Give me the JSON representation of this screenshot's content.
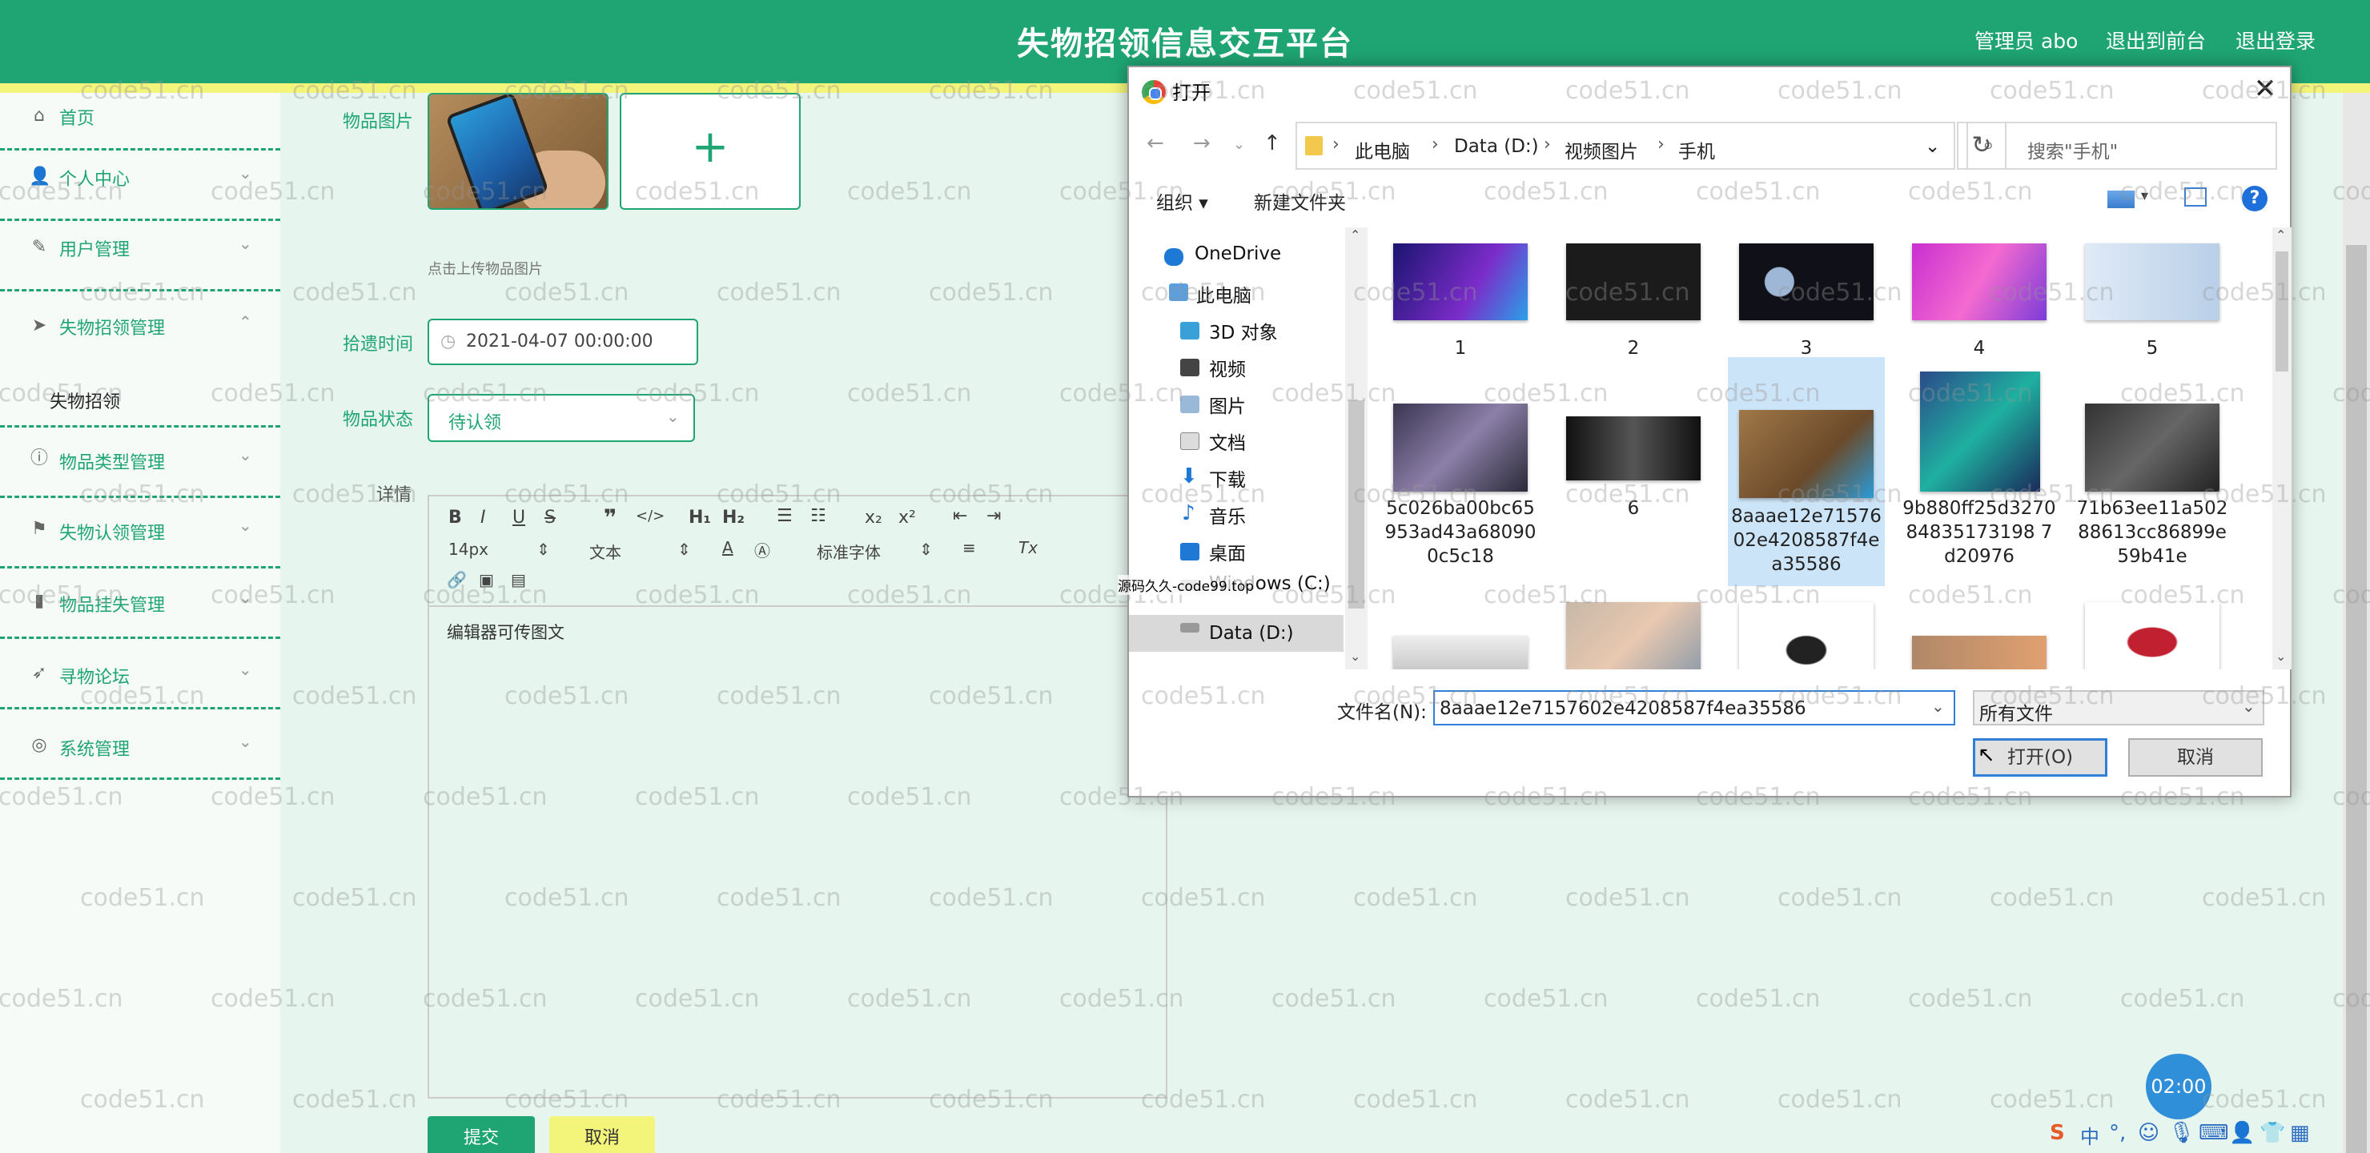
{
  "header": {
    "title": "失物招领信息交互平台",
    "admin": "管理员 abo",
    "back_front": "退出到前台",
    "logout": "退出登录"
  },
  "sidebar": {
    "items": [
      {
        "label": "首页",
        "icon": "home-icon"
      },
      {
        "label": "个人中心",
        "icon": "user-icon"
      },
      {
        "label": "用户管理",
        "icon": "edit-icon"
      },
      {
        "label": "失物招领管理",
        "icon": "send-icon"
      },
      {
        "label": "物品类型管理",
        "icon": "info-icon"
      },
      {
        "label": "失物认领管理",
        "icon": "flag-icon"
      },
      {
        "label": "物品挂失管理",
        "icon": "bar-chart-icon"
      },
      {
        "label": "寻物论坛",
        "icon": "navigate-icon"
      },
      {
        "label": "系统管理",
        "icon": "settings-icon"
      }
    ],
    "sub_item": "失物招领"
  },
  "form": {
    "image_label": "物品图片",
    "upload_hint": "点击上传物品图片",
    "time_label": "拾遗时间",
    "time_value": "2021-04-07 00:00:00",
    "status_label": "物品状态",
    "status_value": "待认领",
    "detail_label": "详情",
    "editor_text": "编辑器可传图文",
    "toolbar": {
      "size": "14px",
      "text_style": "文本",
      "font": "标准字体"
    },
    "submit": "提交",
    "cancel": "取消"
  },
  "dialog": {
    "title": "打开",
    "breadcrumb": [
      "此电脑",
      "Data (D:)",
      "视频图片",
      "手机"
    ],
    "search_placeholder": "搜索\"手机\"",
    "organize": "组织 ▾",
    "new_folder": "新建文件夹",
    "nav_items": [
      "OneDrive",
      "此电脑",
      "3D 对象",
      "视频",
      "图片",
      "文档",
      "下载",
      "音乐",
      "桌面",
      "Windows (C:)",
      "Data (D:)"
    ],
    "files": [
      "1",
      "2",
      "3",
      "4",
      "5",
      "5c026ba00bc65953ad43a680900c5c18",
      "6",
      "8aaae12e7157602e4208587f4ea35586",
      "9b880ff25d327084835173198 7d20976",
      "71b63ee11a50288613cc86899e59b41e"
    ],
    "filename_label": "文件名(N):",
    "filename_value": "8aaae12e7157602e4208587f4ea35586",
    "filetype": "所有文件",
    "open": "打开(O)",
    "cancel": "取消"
  },
  "overlay_text": "源码久久-code99.top",
  "watermark": "code51.cn",
  "timer": "02:00",
  "colors": {
    "brand": "#1fa574",
    "accent": "#f3f47a",
    "selection": "#cce4f7"
  }
}
